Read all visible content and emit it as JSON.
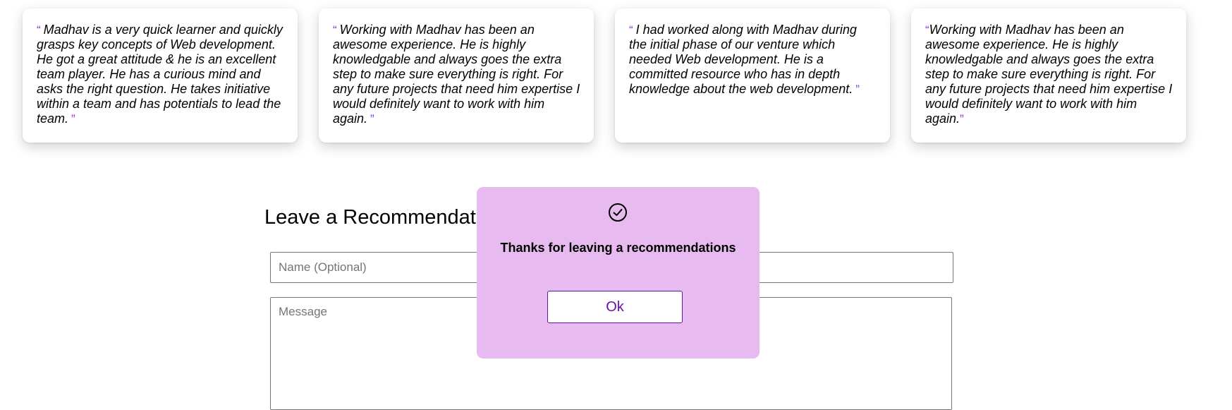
{
  "testimonials": [
    {
      "text": "Madhav is a very quick learner and quickly grasps key concepts of Web development. He got a great attitude & he is an excellent team player. He has a curious mind and asks the right question. He takes initiative within a team and has potentials to lead the team."
    },
    {
      "text": "Working with Madhav has been an awesome experience. He is highly knowledgable and always goes the extra step to make sure everything is right. For any future projects that need him expertise I would definitely want to work with him again."
    },
    {
      "text": "I had worked along with Madhav during the initial phase of our venture which needed Web development. He is a committed resource who has in depth knowledge about the web development."
    },
    {
      "text": "Working with Madhav has been an awesome experience. He is highly knowledgable and always goes the extra step to make sure everything is right. For any future projects that need him expertise I would definitely want to work with him again."
    }
  ],
  "quote_marks": {
    "open": "“",
    "close": "”"
  },
  "form": {
    "title": "Leave a Recommendation",
    "name_placeholder": "Name (Optional)",
    "message_placeholder": "Message"
  },
  "modal": {
    "icon": "check-circle-icon",
    "message": "Thanks for leaving a recommendations",
    "ok_label": "Ok"
  },
  "colors": {
    "accent": "#6a0dad",
    "quote_mark": "#8a2be2",
    "modal_background": "#e7bbef"
  }
}
